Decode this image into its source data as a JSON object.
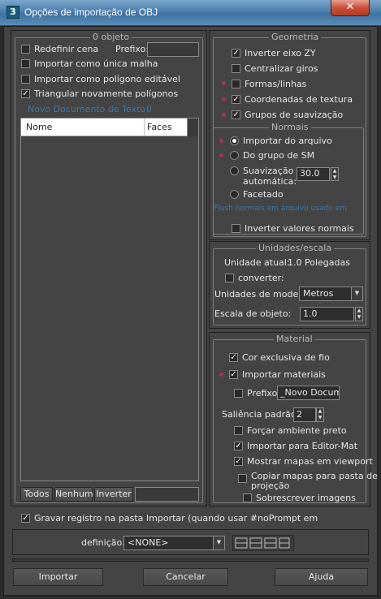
{
  "window": {
    "title": "Opções de importação de OBJ",
    "close_glyph": "✕",
    "app_icon_glyph": "3"
  },
  "object_group": {
    "title": "0 objeto",
    "reset_scene": {
      "label": "Redefinir cena",
      "checked": false
    },
    "prefix_label": "Prefixo:",
    "prefix_value": "",
    "import_single_mesh": {
      "label": "Importar como única malha",
      "checked": false
    },
    "import_editable_poly": {
      "label": "Importar como polígono editável",
      "checked": false
    },
    "retriangulate": {
      "label": "Triangular novamente polígonos",
      "checked": true
    },
    "faint_text": "Novo Documento de Texto",
    "faint_count": "0",
    "table": {
      "columns": [
        "Nome",
        "Faces"
      ],
      "rows": []
    },
    "buttons": {
      "all": "Todos",
      "none": "Nenhum",
      "invert": "Inverter"
    },
    "filter_value": ""
  },
  "geometry_group": {
    "title": "Geometria",
    "flip_zy": {
      "label": "Inverter eixo ZY",
      "checked": true
    },
    "center_pivots": {
      "label": "Centralizar giros",
      "checked": false
    },
    "shapes_lines": {
      "label": "Formas/linhas",
      "checked": false
    },
    "texture_coords": {
      "label": "Coordenadas de textura",
      "checked": true
    },
    "smooth_groups": {
      "label": "Grupos de suavização",
      "checked": true
    }
  },
  "normals_group": {
    "title": "Normais",
    "from_file": {
      "label": "Importar do arquivo",
      "selected": true
    },
    "from_sm": {
      "label": "Do grupo de SM",
      "selected": false
    },
    "auto_smooth": {
      "label_line1": "Suavização",
      "label_line2": "automática:",
      "selected": false,
      "value": "30.0"
    },
    "faceted": {
      "label": "Facetado",
      "selected": false
    },
    "faint_text": "Flush normais em arquivo usado em",
    "invert_normals": {
      "label": "Inverter valores normais",
      "checked": false
    }
  },
  "units_group": {
    "title": "Unidades/escala",
    "current_unit_label": "Unidade atual:",
    "current_unit_value": "1.0 Polegadas",
    "convert": {
      "label": "converter:",
      "checked": false
    },
    "model_units_label": "Unidades de modelo:",
    "model_units_value": "Metros",
    "object_scale_label": "Escala de objeto:",
    "object_scale_value": "1.0"
  },
  "material_group": {
    "title": "Material",
    "unique_wire_color": {
      "label": "Cor exclusiva de fio",
      "checked": true
    },
    "import_materials": {
      "label": "Importar materiais",
      "checked": true
    },
    "prefix": {
      "label": "Prefixo",
      "checked": false,
      "value": "_Novo Documen"
    },
    "default_bump_label": "Saliência padrão:",
    "default_bump_value": "2",
    "force_black_ambient": {
      "label": "Forçar ambiente preto",
      "checked": false
    },
    "import_to_editor": {
      "label": "Importar para Editor-Mat",
      "checked": true
    },
    "show_maps_viewport": {
      "label": "Mostrar mapas em viewport",
      "checked": true
    },
    "copy_maps": {
      "label_line1": "Copiar mapas para pasta de",
      "label_line2": "projeção",
      "checked": false
    },
    "overwrite_images": {
      "label": "Sobrescrever imagens",
      "checked": false
    }
  },
  "log": {
    "label": "Gravar registro na pasta Importar (quando usar  #noPrompt em",
    "checked": true
  },
  "preset": {
    "label": "definição:",
    "value": "<NONE>"
  },
  "footer": {
    "import": "Importar",
    "cancel": "Cancelar",
    "help": "Ajuda"
  }
}
